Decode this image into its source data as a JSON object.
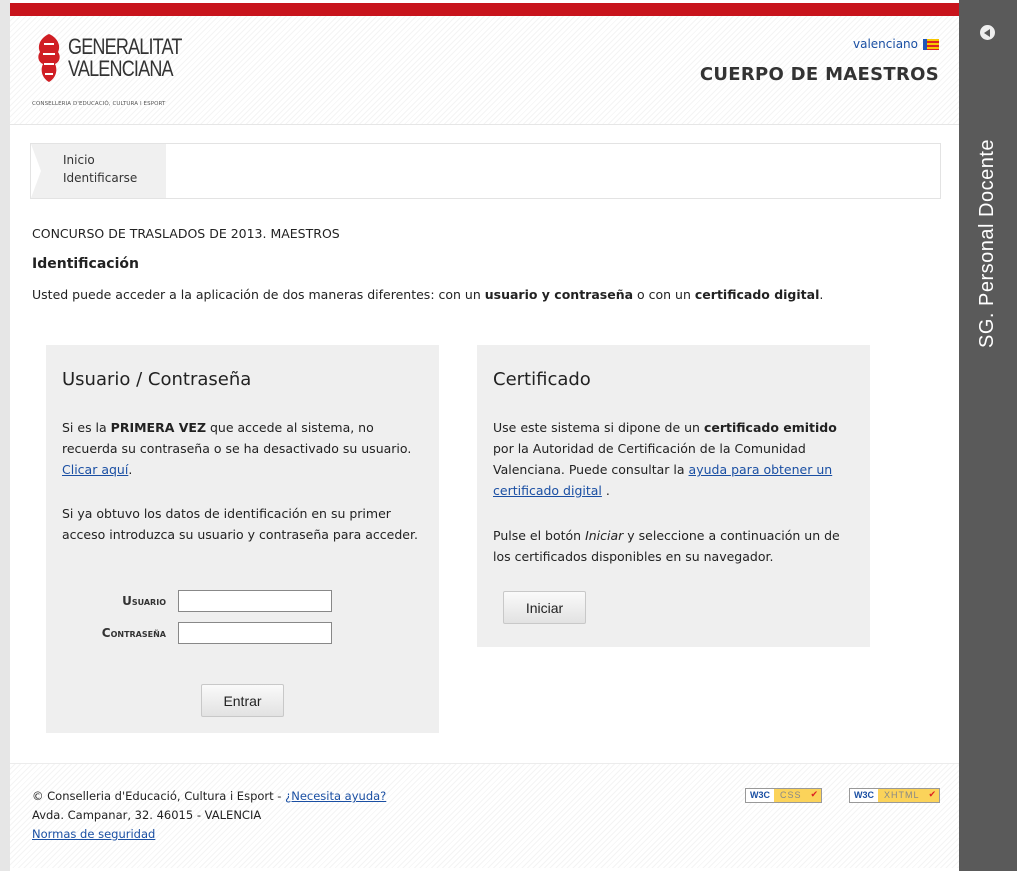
{
  "header": {
    "logo_name_line1": "GENERALITAT",
    "logo_name_line2": "VALENCIANA",
    "logo_subtitle": "CONSELLERIA D'EDUCACIÓ, CULTURA I ESPORT",
    "language_link": "valenciano",
    "title": "CUERPO DE MAESTROS"
  },
  "breadcrumb": {
    "items": [
      "Inicio",
      "Identificarse"
    ]
  },
  "main": {
    "contest_title": "CONCURSO DE TRASLADOS DE 2013. MAESTROS",
    "section_title": "Identificación",
    "intro_pre": "Usted puede acceder a la aplicación de dos maneras diferentes: con un ",
    "intro_bold1": "usuario y contraseña",
    "intro_mid": " o con un ",
    "intro_bold2": "certificado digital",
    "intro_end": "."
  },
  "user_panel": {
    "title": "Usuario / Contraseña",
    "p1_pre": "Si es la ",
    "p1_bold": "PRIMERA VEZ",
    "p1_post": " que accede al sistema, no recuerda su contraseña o se ha desactivado su usuario. ",
    "p1_link": "Clicar aquí",
    "p1_end": ".",
    "p2": "Si ya obtuvo los datos de identificación en su primer acceso introduzca su usuario y contraseña para acceder.",
    "user_label": "Usuario",
    "password_label": "Contraseña",
    "user_value": "",
    "password_value": "",
    "submit_label": "Entrar"
  },
  "cert_panel": {
    "title": "Certificado",
    "p1_pre": "Use este sistema si dipone de un ",
    "p1_bold": "certificado emitido",
    "p1_post": " por la Autoridad de Certificación de la Comunidad Valenciana. Puede consultar la ",
    "p1_link": "ayuda para obtener un certificado digital",
    "p1_end": " .",
    "p2_pre": "Pulse el botón ",
    "p2_em": "Iniciar",
    "p2_post": " y seleccione a continuación un de los certificados disponibles en su navegador.",
    "button_label": "Iniciar"
  },
  "footer": {
    "copyright": "© Conselleria d'Educació, Cultura i Esport - ",
    "help_link": "¿Necesita ayuda?",
    "address": "Avda. Campanar, 32. 46015 - VALENCIA",
    "security_link": "Normas de seguridad",
    "badge_css_w3c": "W3C",
    "badge_css_text": "CSS",
    "badge_xhtml_w3c": "W3C",
    "badge_xhtml_text": "XHTML",
    "badge_check": "✔"
  },
  "sidebar": {
    "label": "SG. Personal Docente"
  },
  "colors": {
    "top_bar": "#c8141c",
    "sidebar": "#5a5a5a",
    "link": "#1a4fa3",
    "panel": "#efefef"
  }
}
